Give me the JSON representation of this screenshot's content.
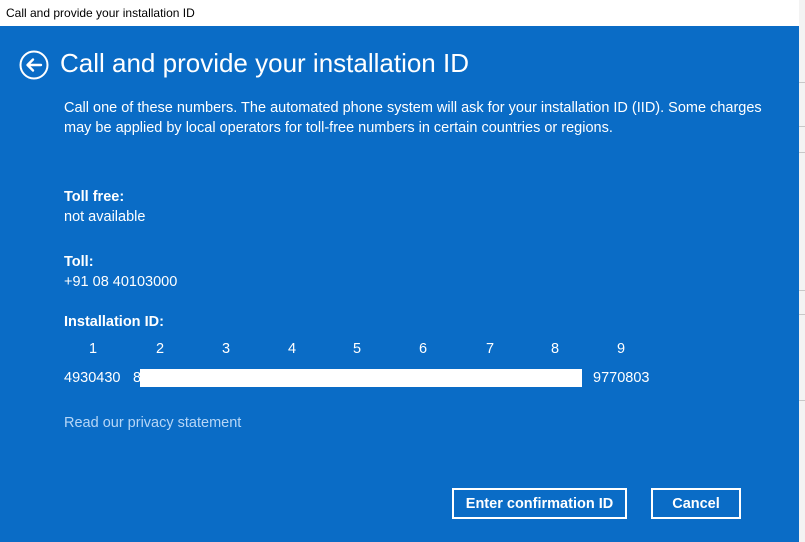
{
  "window": {
    "title": "Call and provide your installation ID"
  },
  "header": {
    "title": "Call and provide your installation ID",
    "back_icon": "back-arrow-circle-icon"
  },
  "description": "Call one of these numbers. The automated phone system will ask for your installation ID (IID). Some charges may be applied by local operators for toll-free numbers in certain countries or regions.",
  "toll_free": {
    "label": "Toll free:",
    "value": "not available"
  },
  "toll": {
    "label": "Toll:",
    "value": "+91 08 40103000"
  },
  "installation_id": {
    "label": "Installation ID:",
    "group_numbers": [
      "1",
      "2",
      "3",
      "4",
      "5",
      "6",
      "7",
      "8",
      "9"
    ],
    "first_group": "4930430",
    "second_group_partial": "8",
    "last_group": "9770803"
  },
  "privacy_link": "Read our privacy statement",
  "buttons": {
    "confirm": "Enter confirmation ID",
    "cancel": "Cancel"
  },
  "colors": {
    "panel_bg": "#0a6cc6",
    "text": "#ffffff",
    "link": "#b6d6f7"
  }
}
